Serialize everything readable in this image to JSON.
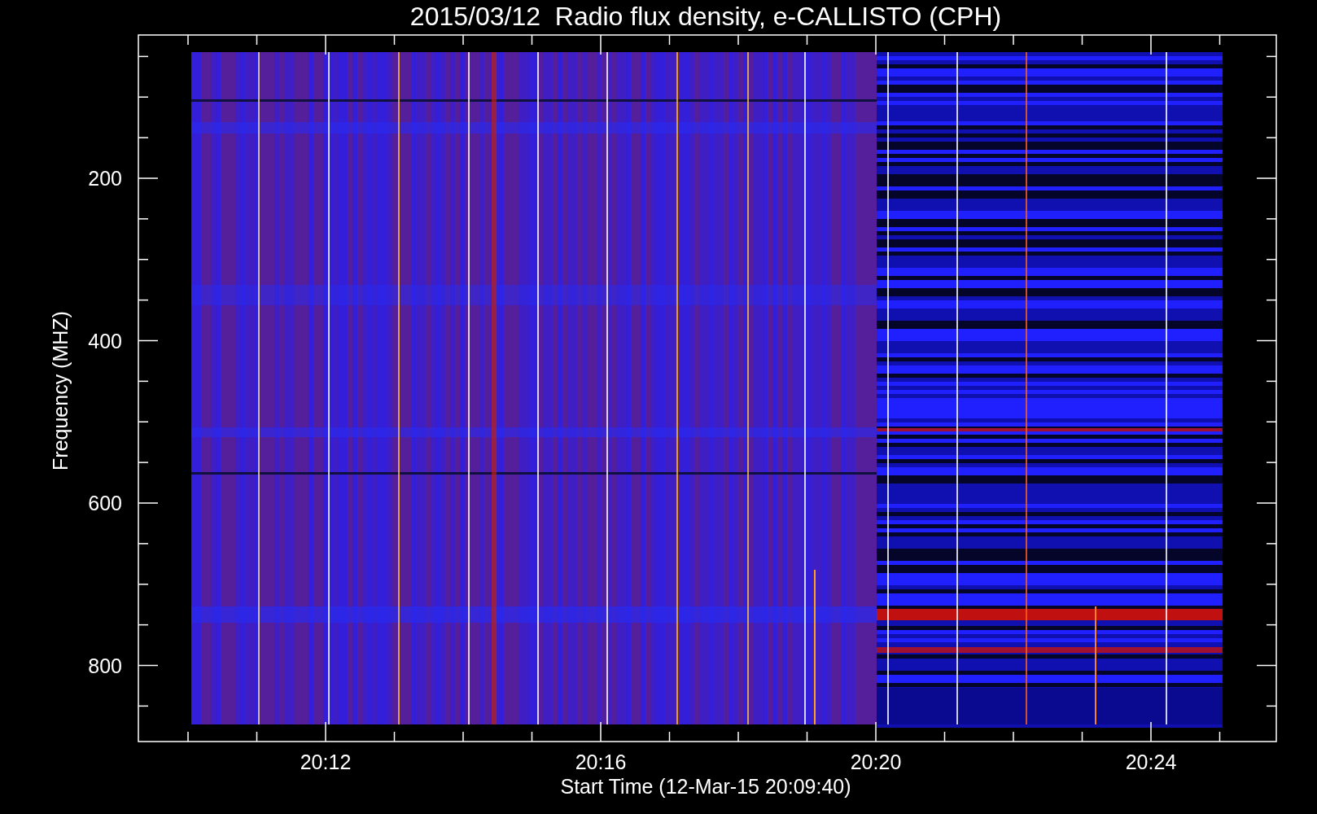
{
  "title": "2015/03/12  Radio flux density, e-CALLISTO (CPH)",
  "y_axis": {
    "label": "Frequency (MHZ)",
    "ticks": [
      "200",
      "400",
      "600",
      "800"
    ]
  },
  "x_axis": {
    "label": "Start Time (12-Mar-15 20:09:40)",
    "ticks": [
      "20:12",
      "20:16",
      "20:20",
      "20:24"
    ]
  }
}
